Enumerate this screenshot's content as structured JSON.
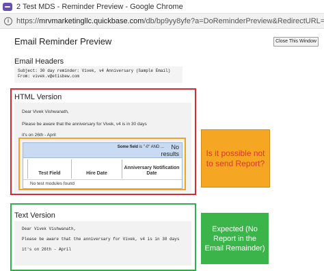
{
  "window": {
    "title": "2 Test MDS - Reminder Preview - Google Chrome",
    "url_prefix": "https://",
    "url_domain": "mrvmarketingllc.quickbase.com",
    "url_path": "/db/bp9yy8yfe?a=DoReminderPreview&RedirectURL=&prob..."
  },
  "page": {
    "title": "Email Reminder Preview",
    "close_button_label": "Close This Window"
  },
  "email_headers": {
    "label": "Email Headers",
    "subject_line": "Subject: 30 day reminder: Vivek, v4 Anniversary (Sample Email)",
    "from_line": "From: vivek.v@etisbew.com"
  },
  "html_version": {
    "label": "HTML Version",
    "greeting": "Dear Vivek Vishwanath,",
    "body_line": "Please be aware that the anniversary for Vivek, v4 is in 30 days",
    "date_line": "it's on 26th - April",
    "report": {
      "filter_text_bold": "Some field",
      "filter_text_rest": " is \"-0\" AND ...",
      "no_results": "No\nresults",
      "columns": [
        "Test Field",
        "Hire Date",
        "Anniversary Notification Date"
      ],
      "empty_message": "No test modules found"
    }
  },
  "text_version": {
    "label": "Text Version",
    "greeting": "Dear Vivek Vishwanath,",
    "body_line": "Please be aware that the anniversary for Vivek, v4 is in 30 days",
    "date_line": "it's on 26th - April"
  },
  "annotations": {
    "question": "Is it possible not to send Report?",
    "expected": "Expected (No Report in the Email Remainder)"
  },
  "colors": {
    "red_frame": "#d72a2a",
    "orange_frame": "#f2a320",
    "green_frame": "#2fb04b",
    "question_bg": "#f5a623",
    "question_text": "#e03333",
    "expected_bg": "#3bb54a",
    "report_header": "#c8dbf3"
  },
  "icons": {
    "app": "quickbase-app-icon",
    "site_info": "info-icon"
  }
}
